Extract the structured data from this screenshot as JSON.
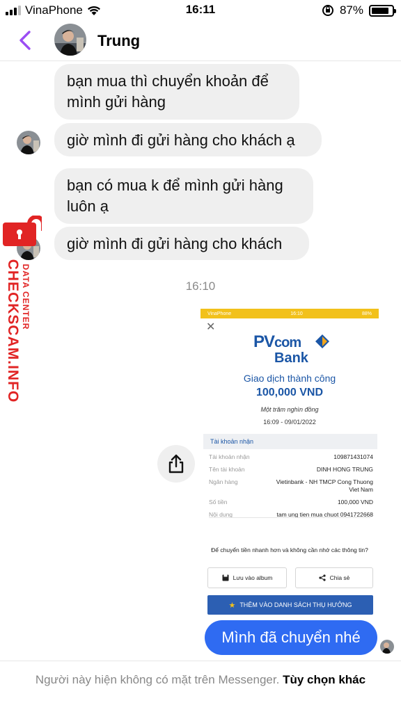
{
  "status_bar": {
    "carrier": "VinaPhone",
    "time": "16:11",
    "battery": "87%"
  },
  "header": {
    "contact_name": "Trung"
  },
  "messages": [
    {
      "text": "bạn mua thì chuyển khoản để mình gửi hàng"
    },
    {
      "text": "giờ mình đi gửi hàng cho khách ạ"
    },
    {
      "text": "bạn có mua k để mình gửi hàng luôn ạ"
    },
    {
      "text": "giờ mình đi gửi hàng cho khách"
    }
  ],
  "timestamp": "16:10",
  "receipt": {
    "status_carrier": "VinaPhone",
    "status_time": "16:10",
    "status_battery": "88%",
    "bank_name": "PVcomBank",
    "bank_line1": "PV",
    "bank_line1b": "com",
    "bank_line2": "Bank",
    "success": "Giao dịch thành công",
    "amount": "100,000 VND",
    "amount_words": "Một trăm nghìn đồng",
    "datetime": "16:09 - 09/01/2022",
    "section_title": "Tài khoản nhận",
    "rows": [
      {
        "label": "Tài khoản nhận",
        "value": "109871431074"
      },
      {
        "label": "Tên tài khoản",
        "value": "DINH HONG TRUNG"
      },
      {
        "label": "Ngân hàng",
        "value": "Vietinbank - NH TMCP Cong Thuong Viet Nam"
      },
      {
        "label": "Số tiền",
        "value": "100,000 VND"
      },
      {
        "label": "Nội dung",
        "value": "tam ung tien mua chuot 0941722668"
      }
    ],
    "prompt": "Để chuyển tiền nhanh hơn và không cần nhớ các thông tin?",
    "save_label": "Lưu vào album",
    "share_label": "Chia sẻ",
    "cta_label": "THÊM VÀO DANH SÁCH THỤ HƯỞNG"
  },
  "own_message": "Mình đã chuyển nhé",
  "footer": {
    "notice": "Người này hiện không có mặt trên Messenger.",
    "option": "Tùy chọn khác"
  },
  "watermark": {
    "big": "CHECKSCAM.INFO",
    "small": "DATA CENTER"
  },
  "colors": {
    "accent": "#9b4df3",
    "own_bubble": "#2f6bf2",
    "received_bubble": "#efefef",
    "bank_blue": "#1b56a6",
    "watermark_red": "#e12424"
  }
}
